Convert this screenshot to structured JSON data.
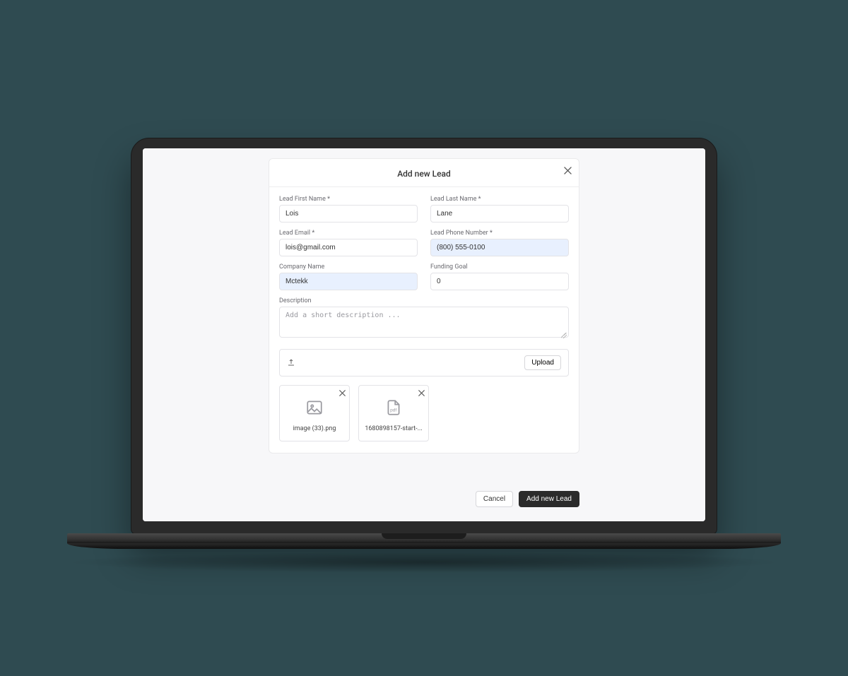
{
  "modal": {
    "title": "Add new Lead",
    "fields": {
      "first_name": {
        "label": "Lead First Name *",
        "value": "Lois"
      },
      "last_name": {
        "label": "Lead Last Name *",
        "value": "Lane"
      },
      "email": {
        "label": "Lead Email *",
        "value": "lois@gmail.com"
      },
      "phone": {
        "label": "Lead Phone Number *",
        "value": "(800) 555-0100"
      },
      "company": {
        "label": "Company Name",
        "value": "Mctekk"
      },
      "funding_goal": {
        "label": "Funding Goal",
        "value": "0"
      },
      "description": {
        "label": "Description",
        "placeholder": "Add a short description ..."
      }
    },
    "upload": {
      "button_label": "Upload"
    },
    "files": [
      {
        "name": "image (33).png",
        "type": "image"
      },
      {
        "name": "1680898157-start-...",
        "type": "pdf"
      }
    ]
  },
  "footer": {
    "cancel_label": "Cancel",
    "submit_label": "Add new Lead"
  }
}
